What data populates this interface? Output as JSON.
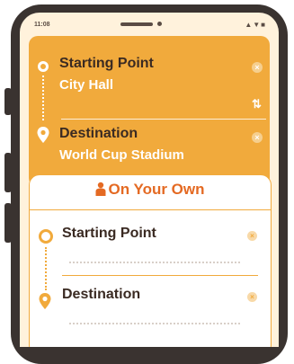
{
  "status_bar": {
    "time": "11:08",
    "icons": "▲▼■"
  },
  "route": {
    "start_label": "Starting Point",
    "start_value": "City Hall",
    "destination_label": "Destination",
    "destination_value": "World Cup Stadium",
    "clear_symbol": "×",
    "swap_symbol": "⇅"
  },
  "own": {
    "title": "On Your Own",
    "start_label": "Starting Point",
    "destination_label": "Destination",
    "clear_symbol": "×"
  },
  "colors": {
    "accent": "#f1aa3c",
    "title": "#e46a23",
    "background": "#fff2dc"
  }
}
